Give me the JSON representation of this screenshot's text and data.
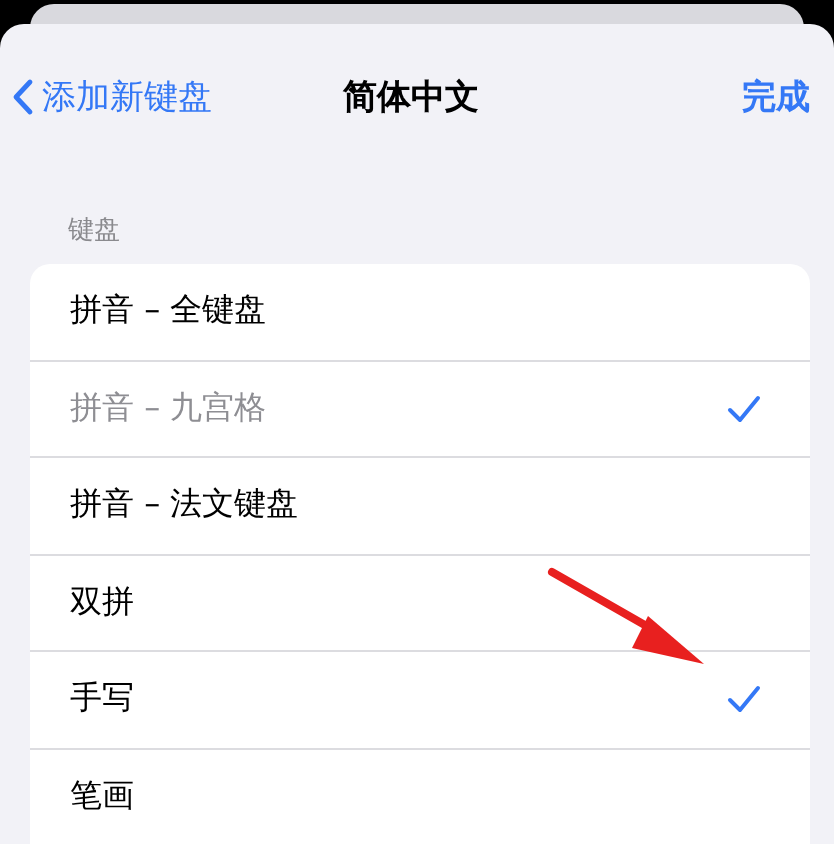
{
  "nav": {
    "back": "添加新键盘",
    "title": "简体中文",
    "done": "完成"
  },
  "section": {
    "header": "键盘",
    "items": [
      {
        "label": "拼音 – 全键盘",
        "checked": false,
        "disabled": false
      },
      {
        "label": "拼音 – 九宫格",
        "checked": true,
        "disabled": true
      },
      {
        "label": "拼音 – 法文键盘",
        "checked": false,
        "disabled": false
      },
      {
        "label": "双拼",
        "checked": false,
        "disabled": false
      },
      {
        "label": "手写",
        "checked": true,
        "disabled": false
      },
      {
        "label": "笔画",
        "checked": false,
        "disabled": false
      }
    ]
  },
  "annotation": {
    "kind": "arrow"
  }
}
